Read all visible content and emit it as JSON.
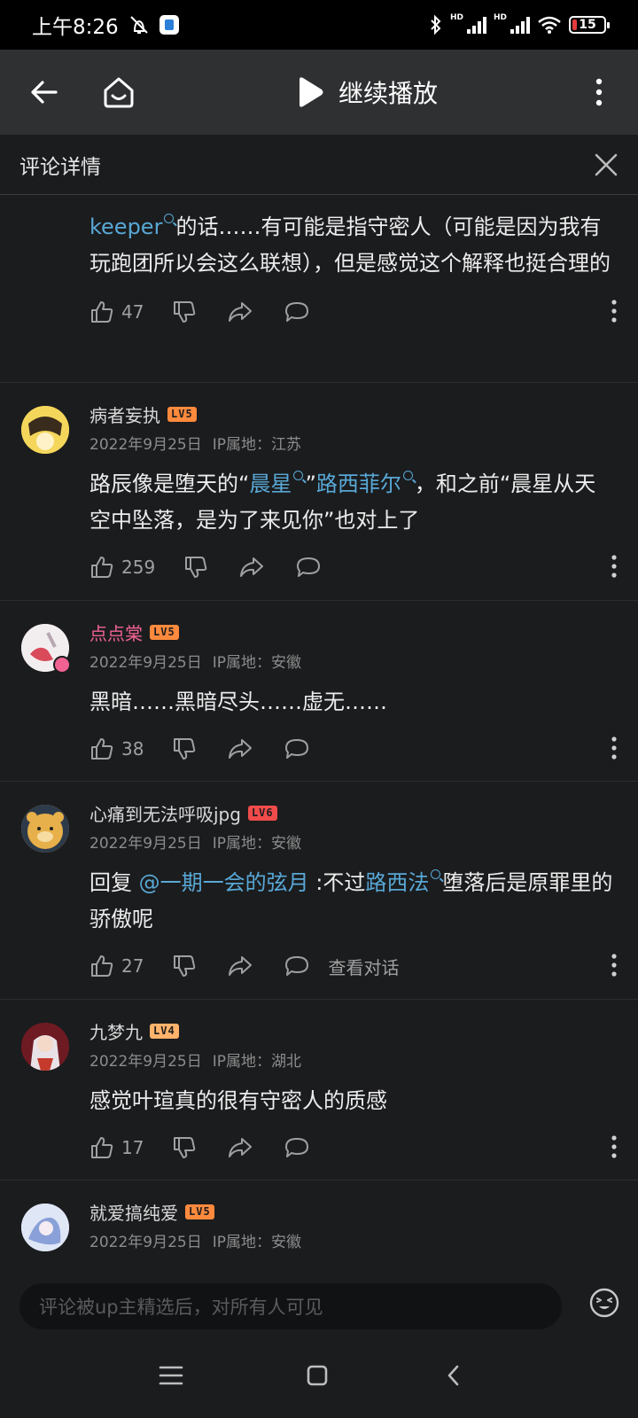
{
  "status_bar": {
    "time": "上午8:26",
    "battery": "15"
  },
  "toolbar": {
    "resume_label": "继续播放"
  },
  "detail": {
    "title": "评论详情"
  },
  "comments": [
    {
      "text_link": "keeper",
      "text_rest": "的话……有可能是指守密人（可能是因为我有玩跑团所以会这么联想），但是感觉这个解释也挺合理的",
      "likes": "47"
    },
    {
      "user": "病者妄执",
      "level": "LV5",
      "date": "2022年9月25日",
      "ip": "IP属地：江苏",
      "t1": "路辰像是堕天的“",
      "link1": "晨星",
      "t2": "”",
      "link2": "路西菲尔",
      "t3": "，和之前“晨星从天空中坠落，是为了来见你”也对上了",
      "likes": "259"
    },
    {
      "user": "点点棠",
      "level": "LV5",
      "date": "2022年9月25日",
      "ip": "IP属地：安徽",
      "text": "黑暗……黑暗尽头……虚无……",
      "likes": "38"
    },
    {
      "user": "心痛到无法呼吸jpg",
      "level": "LV6",
      "date": "2022年9月25日",
      "ip": "IP属地：安徽",
      "t1": "回复 ",
      "mention": "@一期一会的弦月",
      "t2": " :不过",
      "link1": "路西法",
      "t3": "堕落后是原罪里的骄傲呢",
      "likes": "27",
      "view_talk": "查看对话"
    },
    {
      "user": "九梦九",
      "level": "LV4",
      "date": "2022年9月25日",
      "ip": "IP属地：湖北",
      "text": "感觉叶瑄真的很有守密人的质感",
      "likes": "17"
    },
    {
      "user": "就爱搞纯爱",
      "level": "LV5",
      "date": "2022年9月25日",
      "ip": "IP属地：安徽"
    }
  ],
  "input": {
    "placeholder": "评论被up主精选后，对所有人可见"
  },
  "colors": {
    "link": "#58a8d6",
    "vip_name": "#f06292",
    "level_badge": "#ff8a3d"
  }
}
